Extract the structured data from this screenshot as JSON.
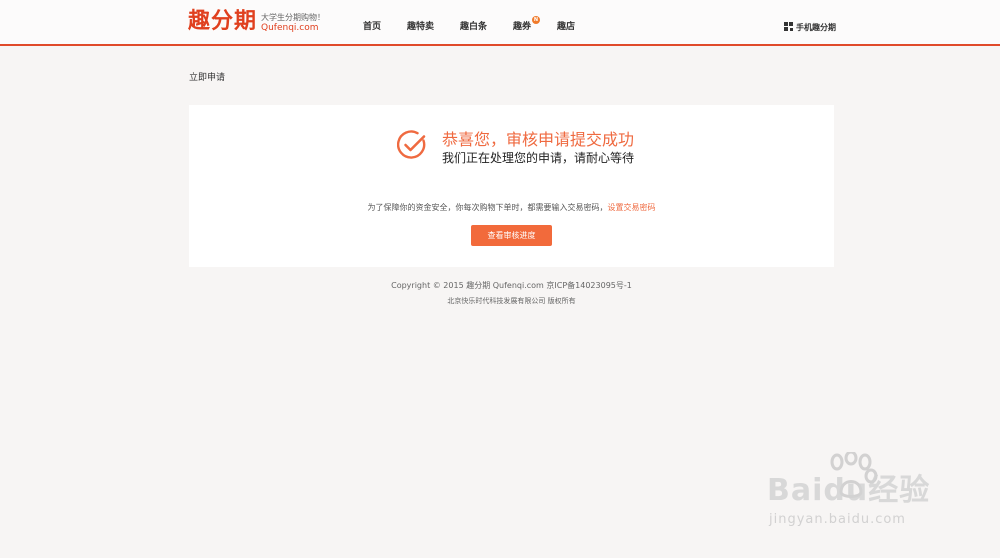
{
  "header": {
    "logo": "趣分期",
    "slogan": "大学生分期购物！",
    "domain": "Qufenqi.com",
    "nav": [
      {
        "label": "首页"
      },
      {
        "label": "趣特卖"
      },
      {
        "label": "趣白条"
      },
      {
        "label": "趣券",
        "badge": "N"
      },
      {
        "label": "趣店"
      }
    ],
    "mobile_label": "手机趣分期"
  },
  "breadcrumb": "立即申请",
  "result": {
    "title": "恭喜您，审核申请提交成功",
    "subtitle": "我们正在处理您的申请，请耐心等待",
    "notice": "为了保障你的资金安全，你每次购物下单时，都需要输入交易密码，",
    "notice_link": "设置交易密码",
    "button_label": "查看审核进度"
  },
  "footer": {
    "line1": "Copyright © 2015 趣分期 Qufenqi.com 京ICP备14023095号-1",
    "line2": "北京快乐时代科技发展有限公司 版权所有"
  },
  "watermark": {
    "logo": "Baidu经验",
    "url": "jingyan.baidu.com"
  },
  "colors": {
    "accent": "#e0401f",
    "button": "#f26a3b",
    "success": "#ef6a40"
  }
}
